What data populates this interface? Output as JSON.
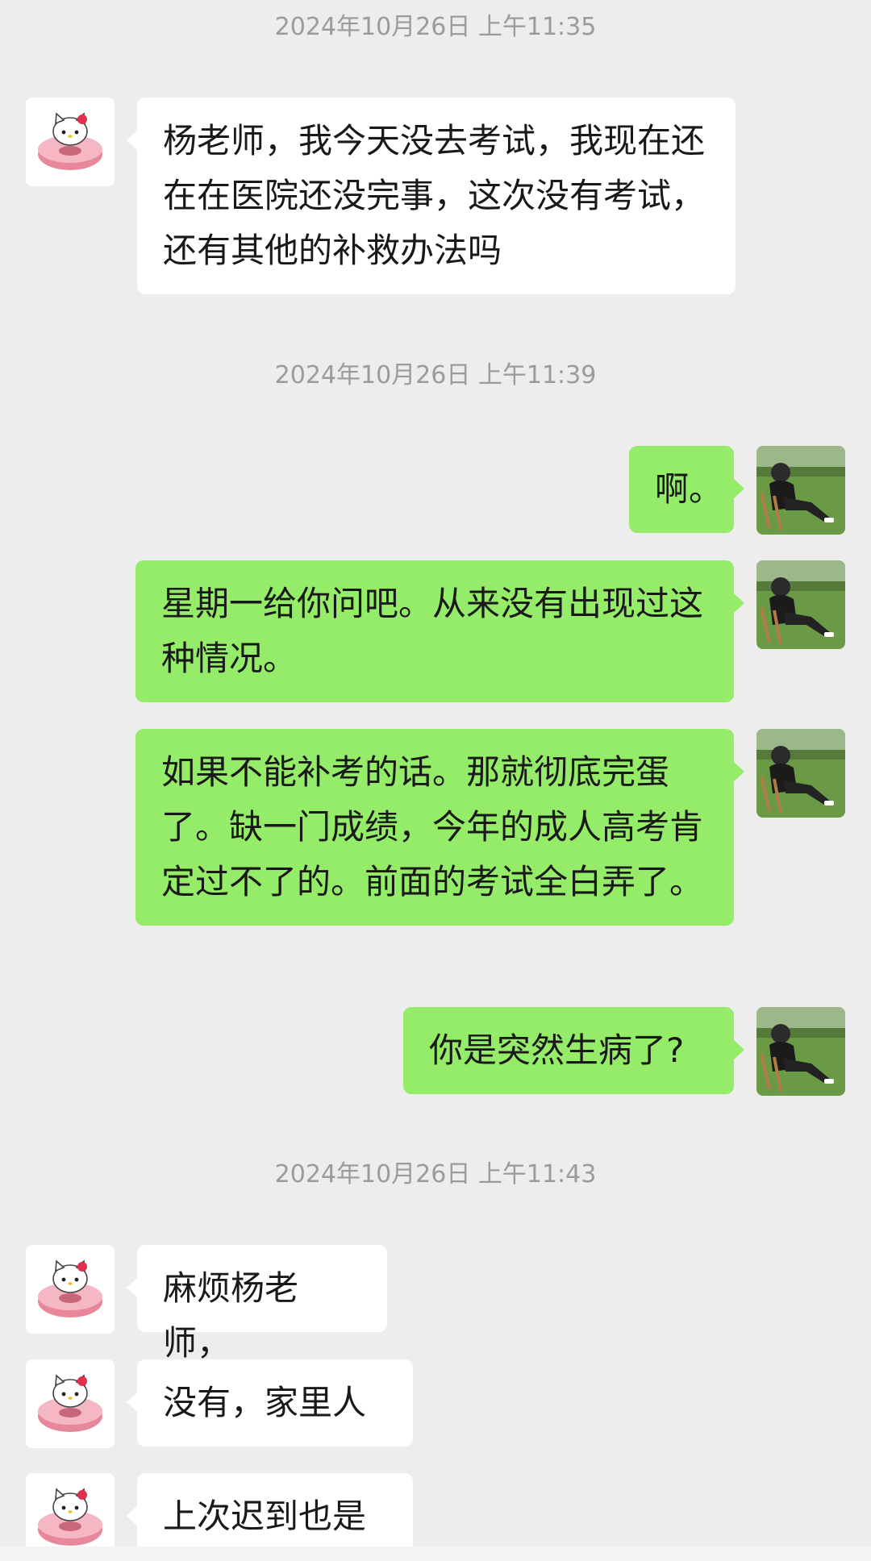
{
  "timestamps": [
    "2024年10月26日 上午11:35",
    "2024年10月26日 上午11:39",
    "2024年10月26日 上午11:43"
  ],
  "messages": [
    {
      "side": "in",
      "text": "杨老师，我今天没去考试，我现在还在在医院还没完事，这次没有考试，还有其他的补救办法吗"
    },
    {
      "side": "out",
      "text": "啊。"
    },
    {
      "side": "out",
      "text": "星期一给你问吧。从来没有出现过这种情况。"
    },
    {
      "side": "out",
      "text": "如果不能补考的话。那就彻底完蛋了。缺一门成绩，今年的成人高考肯定过不了的。前面的考试全白弄了。"
    },
    {
      "side": "out",
      "text": "你是突然生病了?"
    },
    {
      "side": "in",
      "text": "麻烦杨老师，"
    },
    {
      "side": "in",
      "text": "没有，家里人"
    },
    {
      "side": "in",
      "text": "上次迟到也是"
    }
  ],
  "icons": {
    "contact_avatar": "hello-kitty-donut-icon",
    "self_avatar": "person-sitting-photo-icon"
  },
  "colors": {
    "background": "#ededed",
    "incoming_bubble": "#ffffff",
    "outgoing_bubble": "#95ec69",
    "timestamp_text": "#9b9b9b"
  }
}
